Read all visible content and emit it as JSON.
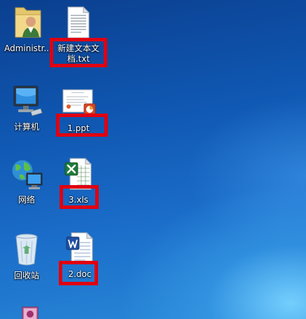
{
  "desktop": {
    "icons": {
      "administrator": {
        "label": "Administr...",
        "icon": "user-folder-icon"
      },
      "new_text_doc": {
        "label": "新建文本文档.txt",
        "icon": "text-document-icon"
      },
      "computer": {
        "label": "计算机",
        "icon": "computer-icon"
      },
      "ppt": {
        "label": "1.ppt",
        "icon": "powerpoint-document-icon"
      },
      "network": {
        "label": "网络",
        "icon": "network-globe-icon"
      },
      "xls": {
        "label": "3.xls",
        "icon": "excel-document-icon"
      },
      "recycle": {
        "label": "回收站",
        "icon": "recycle-bin-icon"
      },
      "doc": {
        "label": "2.doc",
        "icon": "word-document-icon"
      },
      "partial": {
        "label": "",
        "icon": "access-app-icon"
      }
    }
  },
  "colors": {
    "highlight_box": "#e00010",
    "label_text": "#ffffff"
  }
}
